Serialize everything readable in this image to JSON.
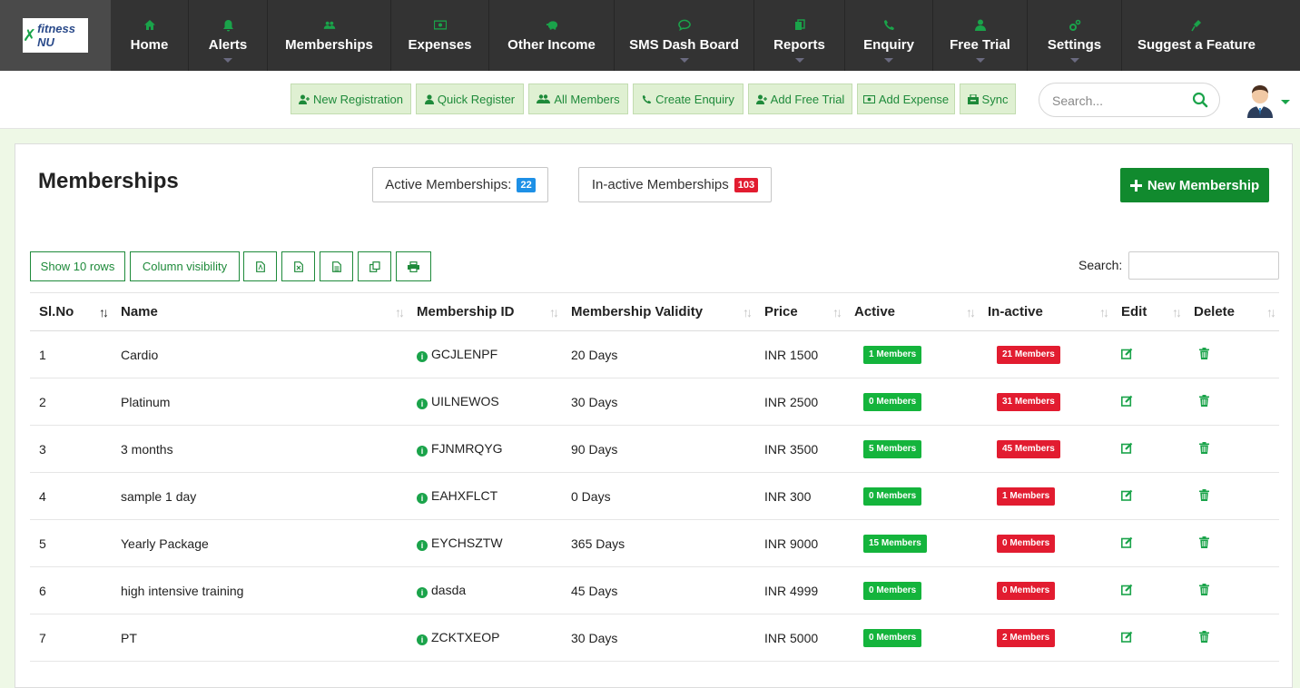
{
  "brand": {
    "logo_text": "fitness NU"
  },
  "nav": [
    {
      "label": "Home",
      "icon": "home-icon"
    },
    {
      "label": "Alerts",
      "icon": "bell-icon",
      "dropdown": true
    },
    {
      "label": "Memberships",
      "icon": "users-icon"
    },
    {
      "label": "Expenses",
      "icon": "money-icon"
    },
    {
      "label": "Other Income",
      "icon": "piggy-bank-icon"
    },
    {
      "label": "SMS Dash Board",
      "icon": "chat-icon",
      "dropdown": true
    },
    {
      "label": "Reports",
      "icon": "copy-icon",
      "dropdown": true
    },
    {
      "label": "Enquiry",
      "icon": "phone-icon",
      "dropdown": true
    },
    {
      "label": "Free Trial",
      "icon": "user-icon",
      "dropdown": true
    },
    {
      "label": "Settings",
      "icon": "cogs-icon",
      "dropdown": true
    },
    {
      "label": "Suggest a Feature",
      "icon": "microphone-icon"
    }
  ],
  "quick_actions": [
    {
      "label": "New Registration",
      "icon": "user-plus-icon"
    },
    {
      "label": "Quick Register",
      "icon": "user-icon"
    },
    {
      "label": "All Members",
      "icon": "users-icon"
    },
    {
      "label": "Create Enquiry",
      "icon": "phone-icon"
    },
    {
      "label": "Add Free Trial",
      "icon": "user-plus-icon"
    },
    {
      "label": "Add Expense",
      "icon": "money-icon"
    },
    {
      "label": "Sync",
      "icon": "fax-icon"
    }
  ],
  "top_search": {
    "placeholder": "Search..."
  },
  "page": {
    "title": "Memberships",
    "active_label": "Active Memberships:",
    "active_count": "22",
    "inactive_label": "In-active Memberships",
    "inactive_count": "103",
    "new_button": "New Membership"
  },
  "table_tools": {
    "show_rows": "Show 10 rows",
    "column_visibility": "Column visibility",
    "export_icons": [
      "pdf-icon",
      "excel-icon",
      "csv-icon",
      "copy-icon",
      "print-icon"
    ],
    "search_label": "Search:"
  },
  "table": {
    "columns": [
      "Sl.No",
      "Name",
      "Membership ID",
      "Membership Validity",
      "Price",
      "Active",
      "In-active",
      "Edit",
      "Delete"
    ],
    "rows": [
      {
        "sl": "1",
        "name": "Cardio",
        "id": "GCJLENPF",
        "validity": "20 Days",
        "price": "INR 1500",
        "active": "1 Members",
        "inactive": "21 Members"
      },
      {
        "sl": "2",
        "name": "Platinum",
        "id": "UILNEWOS",
        "validity": "30 Days",
        "price": "INR 2500",
        "active": "0 Members",
        "inactive": "31 Members"
      },
      {
        "sl": "3",
        "name": "3 months",
        "id": "FJNMRQYG",
        "validity": "90 Days",
        "price": "INR 3500",
        "active": "5 Members",
        "inactive": "45 Members"
      },
      {
        "sl": "4",
        "name": "sample 1 day",
        "id": "EAHXFLCT",
        "validity": "0 Days",
        "price": "INR 300",
        "active": "0 Members",
        "inactive": "1 Members"
      },
      {
        "sl": "5",
        "name": "Yearly Package",
        "id": "EYCHSZTW",
        "validity": "365 Days",
        "price": "INR 9000",
        "active": "15 Members",
        "inactive": "0 Members"
      },
      {
        "sl": "6",
        "name": "high intensive training",
        "id": "dasda",
        "validity": "45 Days",
        "price": "INR 4999",
        "active": "0 Members",
        "inactive": "0 Members"
      },
      {
        "sl": "7",
        "name": "PT",
        "id": "ZCKTXEOP",
        "validity": "30 Days",
        "price": "INR 5000",
        "active": "0 Members",
        "inactive": "2 Members"
      }
    ]
  },
  "colors": {
    "accent_green": "#1aa34a",
    "nav_bg": "#333333",
    "danger_red": "#e21c30",
    "info_blue": "#1e90e6"
  }
}
